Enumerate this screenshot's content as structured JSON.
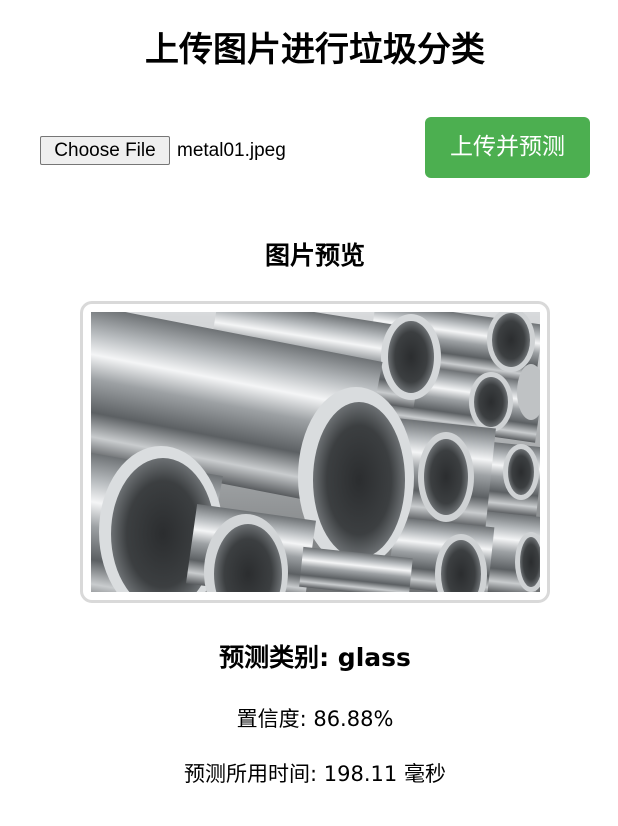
{
  "page": {
    "title": "上传图片进行垃圾分类"
  },
  "upload": {
    "choose_file_label": "Choose File",
    "file_name": "metal01.jpeg",
    "submit_label": "上传并预测"
  },
  "preview": {
    "title": "图片预览",
    "image_description": "metal-pipes-photo"
  },
  "result": {
    "category_label": "预测类别: glass",
    "confidence_label": "置信度: 86.88%",
    "time_label": "预测所用时间: 198.11 毫秒"
  },
  "colors": {
    "submit_button": "#4caf50",
    "frame_border": "#d9d9d9"
  }
}
